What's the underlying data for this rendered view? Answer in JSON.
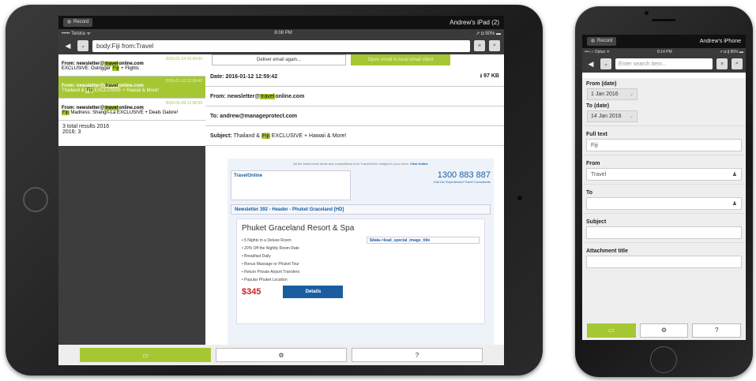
{
  "ipad": {
    "record_label": "Record",
    "device_name": "Andrew's iPad (2)",
    "status": {
      "carrier": "••••• Telstra ᯤ",
      "time": "8:08 PM",
      "battery": "➚ ◘ 90% ▬"
    },
    "search": {
      "query": "body:Fiji from:Travel",
      "clear": "×",
      "search_icon": "⌕"
    },
    "results": [
      {
        "date": "2016-01-14 15:43:00",
        "from_pre": "From: newsletter@",
        "from_hl": "travel",
        "from_post": "online.com",
        "sub_pre": "EXCLUSIVE: Outrigger ",
        "sub_hl": "Fiji",
        "sub_post": " + Flights"
      },
      {
        "date": "2016-01-12 12:59:42",
        "from_pre": "From: newsletter@",
        "from_hl": "travel",
        "from_post": "online.com",
        "sub_pre": "Thailand & ",
        "sub_hl": "Fiji",
        "sub_post": " EXCLUSIVE + Hawaii & More!"
      },
      {
        "date": "2016-01-09 12:58:39",
        "from_pre": "From: newsletter@",
        "from_hl": "travel",
        "from_post": "online.com",
        "sub_pre": "",
        "sub_hl": "Fiji",
        "sub_post": " Madness: Shangri-La EXCLUSIVE + Deals Galore!"
      }
    ],
    "totals": {
      "line1": "3 total results 2016",
      "line2": "2016: 3"
    },
    "actions": {
      "deliver": "Deliver email again...",
      "open_local": "Open email in local email client"
    },
    "message": {
      "date": "Date: 2016-01-12 12:59:42",
      "size": "⭳ 97 KB",
      "from_pre": "From: newsletter@",
      "from_hl": "travel",
      "from_post": "online.com",
      "to": "To: andrew@manageprotect.com",
      "subject_label": "Subject:",
      "subject_pre": " Thailand & ",
      "subject_hl": "Fiji",
      "subject_post": " EXCLUSIVE + Hawaii & More!"
    },
    "newsletter": {
      "top_line": "All the latest travel deals and competitions from TravelOnline straight to your inbox.",
      "view_online": "View Online",
      "logo": "TravelOnline",
      "phone": "1300 883 887",
      "phone_caption": "Call Our Experienced Travel Consultants",
      "header": "Newsletter 392 - Header - Phuket Graceland [HD]",
      "title": "Phuket Graceland Resort & Spa",
      "features": [
        "• 5 Nights in a Deluxe Room",
        "• 20% Off the Nightly Room Rate",
        "• Breakfast Daily",
        "• Bonus Massage or Phuket Tour",
        "• Return Private Airport Transfers",
        "• Popular Phuket Location"
      ],
      "image_placeholder": "$data->lead_special_image_title",
      "price": "$345",
      "details": "Details"
    },
    "toolbar": {
      "mail_icon": "▭",
      "settings_icon": "⚙",
      "help": "?"
    }
  },
  "iphone": {
    "record_label": "Record",
    "device_name": "Andrew's iPhone",
    "status": {
      "carrier": "•••○○ Optus ᯤ",
      "time": "8:14 PM",
      "battery": "➚ ◘ ∦ 86% ▬"
    },
    "search": {
      "placeholder": "Enter search item...",
      "clear": "×",
      "search_icon": "⌕"
    },
    "form": {
      "from_date_label": "From (date)",
      "from_date_value": "1 Jan 2016",
      "to_date_label": "To (date)",
      "to_date_value": "14 Jan 2016",
      "fulltext_label": "Full text",
      "fulltext_value": "Fiji",
      "from_label": "From",
      "from_value": "Travel",
      "to_label": "To",
      "to_value": "",
      "subject_label": "Subject",
      "subject_value": "",
      "attachment_label": "Attachment title",
      "attachment_value": ""
    },
    "toolbar": {
      "mail_icon": "▭",
      "settings_icon": "⚙",
      "help": "?"
    }
  }
}
